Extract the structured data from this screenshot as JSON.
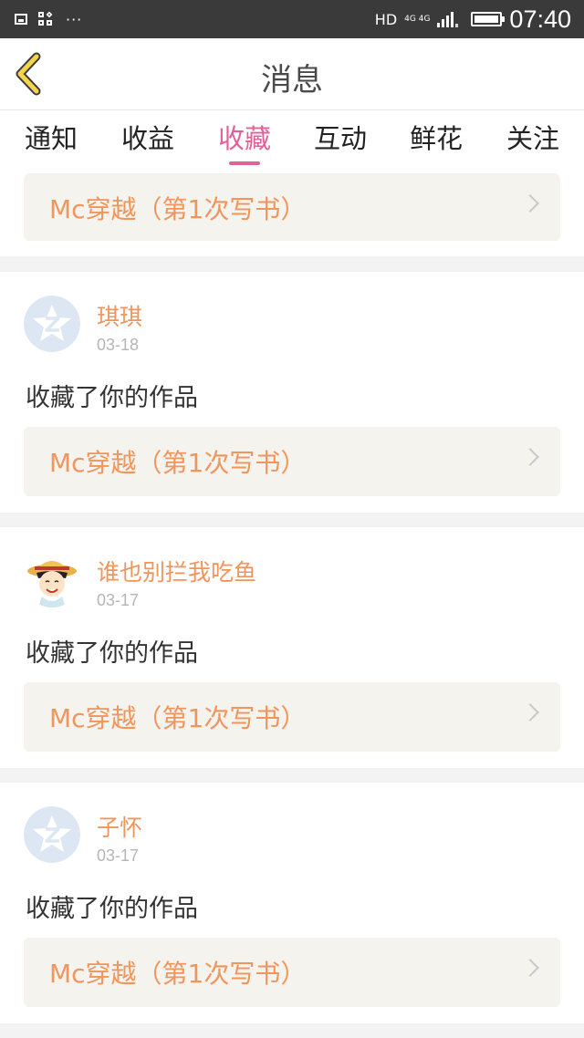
{
  "status_bar": {
    "hd": "HD",
    "network_top": "4G 4G",
    "time": "07:40",
    "more": "···"
  },
  "header": {
    "title": "消息",
    "back_icon": "chevron-left-icon"
  },
  "tabs": [
    {
      "label": "通知",
      "active": false
    },
    {
      "label": "收益",
      "active": false
    },
    {
      "label": "收藏",
      "active": true
    },
    {
      "label": "互动",
      "active": false
    },
    {
      "label": "鲜花",
      "active": false
    },
    {
      "label": "关注",
      "active": false
    }
  ],
  "top_partial_card": {
    "book_title": "Mc穿越（第1次写书）"
  },
  "messages": [
    {
      "avatar": "qzone-default-avatar",
      "username": "琪琪",
      "date": "03-18",
      "action": "收藏了你的作品",
      "book_title": "Mc穿越（第1次写书）"
    },
    {
      "avatar": "anime-character-avatar",
      "username": "谁也别拦我吃鱼",
      "date": "03-17",
      "action": "收藏了你的作品",
      "book_title": "Mc穿越（第1次写书）"
    },
    {
      "avatar": "qzone-default-avatar",
      "username": "子怀",
      "date": "03-17",
      "action": "收藏了你的作品",
      "book_title": "Mc穿越（第1次写书）"
    }
  ],
  "colors": {
    "accent": "#e0629b",
    "name": "#f0955c",
    "status_bar": "#3a3a3a"
  }
}
